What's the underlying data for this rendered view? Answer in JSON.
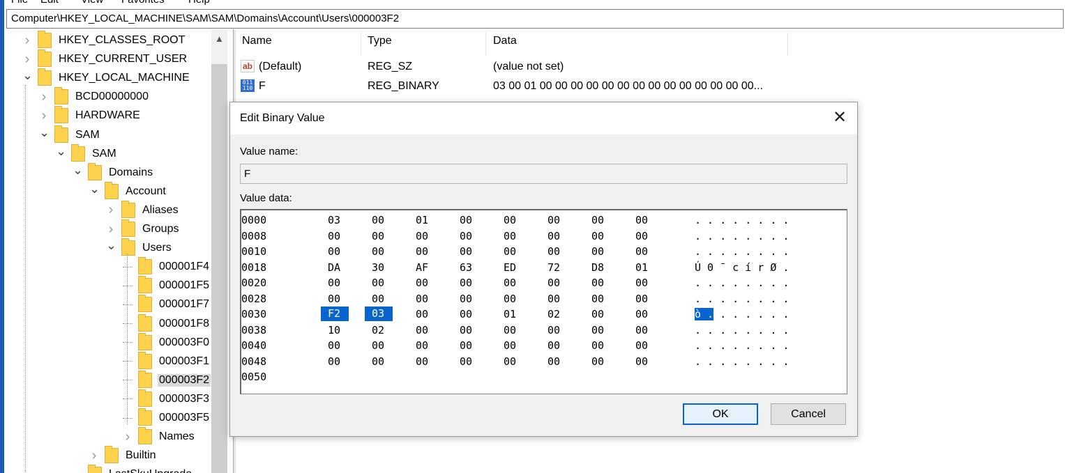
{
  "menu": [
    "File",
    "Edit",
    "View",
    "Favorites",
    "Help"
  ],
  "address": "Computer\\HKEY_LOCAL_MACHINE\\SAM\\SAM\\Domains\\Account\\Users\\000003F2",
  "tree": [
    {
      "label": "HKEY_CLASSES_ROOT",
      "expanded": false
    },
    {
      "label": "HKEY_CURRENT_USER",
      "expanded": false
    },
    {
      "label": "HKEY_LOCAL_MACHINE",
      "expanded": true
    },
    {
      "label": "BCD00000000",
      "expanded": false
    },
    {
      "label": "HARDWARE",
      "expanded": false
    },
    {
      "label": "SAM",
      "expanded": true
    },
    {
      "label": "SAM",
      "expanded": true
    },
    {
      "label": "Domains",
      "expanded": true
    },
    {
      "label": "Account",
      "expanded": true
    },
    {
      "label": "Aliases",
      "expanded": false
    },
    {
      "label": "Groups",
      "expanded": false
    },
    {
      "label": "Users",
      "expanded": true
    },
    {
      "label": "000001F4",
      "expanded": null
    },
    {
      "label": "000001F5",
      "expanded": null
    },
    {
      "label": "000001F7",
      "expanded": null
    },
    {
      "label": "000001F8",
      "expanded": null
    },
    {
      "label": "000003F0",
      "expanded": null
    },
    {
      "label": "000003F1",
      "expanded": null
    },
    {
      "label": "000003F2",
      "expanded": null,
      "selected": true
    },
    {
      "label": "000003F3",
      "expanded": null
    },
    {
      "label": "000003F5",
      "expanded": null
    },
    {
      "label": "Names",
      "expanded": false
    },
    {
      "label": "Builtin",
      "expanded": false
    },
    {
      "label": "LastSkuUpgrade",
      "expanded": null
    }
  ],
  "list": {
    "headers": [
      "Name",
      "Type",
      "Data"
    ],
    "rows": [
      {
        "icon": "string-value-icon",
        "name": "(Default)",
        "type": "REG_SZ",
        "data": "(value not set)"
      },
      {
        "icon": "binary-value-icon",
        "name": "F",
        "type": "REG_BINARY",
        "data": "03 00 01 00 00 00 00 00 00 00 00 00 00 00 00 00 00..."
      }
    ]
  },
  "dialog": {
    "title": "Edit Binary Value",
    "close_glyph": "✕",
    "value_name_label": "Value name:",
    "value_name": "F",
    "value_data_label": "Value data:",
    "hex_rows": [
      {
        "offset": "0000",
        "bytes": [
          "03",
          "00",
          "01",
          "00",
          "00",
          "00",
          "00",
          "00"
        ],
        "ascii": ". . . . . . . ."
      },
      {
        "offset": "0008",
        "bytes": [
          "00",
          "00",
          "00",
          "00",
          "00",
          "00",
          "00",
          "00"
        ],
        "ascii": ". . . . . . . ."
      },
      {
        "offset": "0010",
        "bytes": [
          "00",
          "00",
          "00",
          "00",
          "00",
          "00",
          "00",
          "00"
        ],
        "ascii": ". . . . . . . ."
      },
      {
        "offset": "0018",
        "bytes": [
          "DA",
          "30",
          "AF",
          "63",
          "ED",
          "72",
          "D8",
          "01"
        ],
        "ascii": "Ú 0 ¯ c í r Ø ."
      },
      {
        "offset": "0020",
        "bytes": [
          "00",
          "00",
          "00",
          "00",
          "00",
          "00",
          "00",
          "00"
        ],
        "ascii": ". . . . . . . ."
      },
      {
        "offset": "0028",
        "bytes": [
          "00",
          "00",
          "00",
          "00",
          "00",
          "00",
          "00",
          "00"
        ],
        "ascii": ". . . . . . . ."
      },
      {
        "offset": "0030",
        "bytes": [
          "F2",
          "03",
          "00",
          "00",
          "01",
          "02",
          "00",
          "00"
        ],
        "ascii": "ò . . . . . . ."
      },
      {
        "offset": "0038",
        "bytes": [
          "10",
          "02",
          "00",
          "00",
          "00",
          "00",
          "00",
          "00"
        ],
        "ascii": ". . . . . . . ."
      },
      {
        "offset": "0040",
        "bytes": [
          "00",
          "00",
          "00",
          "00",
          "00",
          "00",
          "00",
          "00"
        ],
        "ascii": ". . . . . . . ."
      },
      {
        "offset": "0048",
        "bytes": [
          "00",
          "00",
          "00",
          "00",
          "00",
          "00",
          "00",
          "00"
        ],
        "ascii": ". . . . . . . ."
      },
      {
        "offset": "0050",
        "bytes": [],
        "ascii": ""
      }
    ],
    "ok_label": "OK",
    "cancel_label": "Cancel"
  },
  "colors": {
    "selection": "#0a64d0",
    "folder": "#ffd24d"
  }
}
